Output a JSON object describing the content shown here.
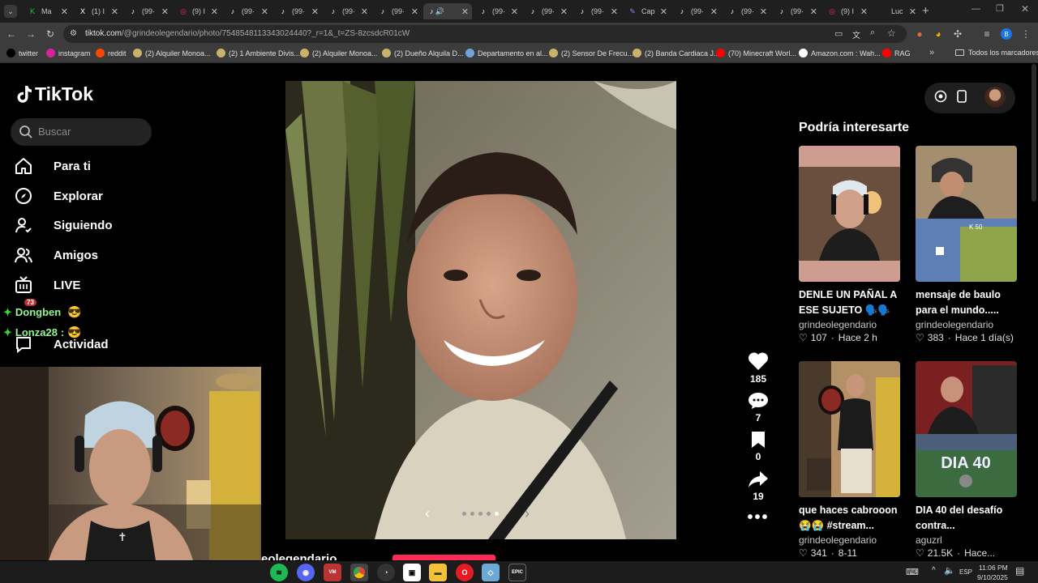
{
  "browser": {
    "tabs": [
      {
        "label": "Ma",
        "icon": "green-k-icon"
      },
      {
        "label": "(1) I",
        "icon": "x-icon"
      },
      {
        "label": "(99·",
        "icon": "tiktok-icon"
      },
      {
        "label": "(9) I",
        "icon": "instagram-icon"
      },
      {
        "label": "(99·",
        "icon": "tiktok-icon"
      },
      {
        "label": "(99·",
        "icon": "tiktok-icon"
      },
      {
        "label": "(99·",
        "icon": "tiktok-icon"
      },
      {
        "label": "(99·",
        "icon": "tiktok-icon"
      },
      {
        "label": "",
        "icon": "tiktok-icon"
      },
      {
        "label": "(99·",
        "icon": "tiktok-icon"
      },
      {
        "label": "(99·",
        "icon": "tiktok-icon"
      },
      {
        "label": "(99·",
        "icon": "tiktok-icon"
      },
      {
        "label": "Cap",
        "icon": "pen-icon"
      },
      {
        "label": "(99·",
        "icon": "tiktok-icon"
      },
      {
        "label": "(99·",
        "icon": "tiktok-icon"
      },
      {
        "label": "(99·",
        "icon": "tiktok-icon"
      },
      {
        "label": "(9) I",
        "icon": "instagram-icon"
      },
      {
        "label": "Luc",
        "icon": "blank-icon"
      }
    ],
    "url_domain": "tiktok.com",
    "url_path": "/@grindeolegendario/photo/7548548113343024440?_r=1&_t=ZS-8zcsdcR01cW",
    "bookmarks": [
      {
        "label": "twitter",
        "color": "#000000"
      },
      {
        "label": "instagram",
        "color": "#d6249f"
      },
      {
        "label": "reddit",
        "color": "#ff4500"
      },
      {
        "label": "(2) Alquiler Monoa...",
        "color": "#c9b36b"
      },
      {
        "label": "(2) 1 Ambiente Divis...",
        "color": "#c9b36b"
      },
      {
        "label": "(2) Alquiler Monoa...",
        "color": "#c9b36b"
      },
      {
        "label": "(2) Dueño Alquila D...",
        "color": "#c9b36b"
      },
      {
        "label": "Departamento en al...",
        "color": "#6fa3d8"
      },
      {
        "label": "(2) Sensor De Frecu...",
        "color": "#c9b36b"
      },
      {
        "label": "(2) Banda Cardiaca J...",
        "color": "#c9b36b"
      },
      {
        "label": "(70) Minecraft Worl...",
        "color": "#ff0000"
      },
      {
        "label": "Amazon.com : Wah...",
        "color": "#ffffff"
      },
      {
        "label": "RAG",
        "color": "#ff0000"
      }
    ],
    "all_bookmarks": "Todos los marcadores"
  },
  "tiktok": {
    "logo": "TikTok",
    "search_placeholder": "Buscar",
    "nav": [
      {
        "label": "Para ti",
        "icon": "home-icon"
      },
      {
        "label": "Explorar",
        "icon": "compass-icon"
      },
      {
        "label": "Siguiendo",
        "icon": "following-icon"
      },
      {
        "label": "Amigos",
        "icon": "friends-icon"
      },
      {
        "label": "LIVE",
        "icon": "live-icon"
      },
      {
        "label": "Actividad",
        "icon": "activity-icon"
      }
    ],
    "chat": [
      {
        "user": "Dongben",
        "sep": "",
        "badge": "73"
      },
      {
        "user": "Lonza28",
        "sep": ":",
        "badge": ""
      }
    ],
    "author_partial": "eolegendario",
    "actions": {
      "likes": "185",
      "comments": "7",
      "saves": "0",
      "shares": "19"
    },
    "carousel": {
      "count": 5,
      "active": 4
    },
    "recommend_title": "Podría interesarte",
    "recommendations": [
      {
        "title": "DENLE UN PAÑAL A ESE SUJETO 🗣️🗣️🔥...",
        "author": "grindeolegendario",
        "likes": "107",
        "time": "Hace 2 h"
      },
      {
        "title": "mensaje de baulo para el mundo.....",
        "author": "grindeolegendario",
        "likes": "383",
        "time": "Hace 1 día(s)"
      },
      {
        "title": "que haces cabrooon 😭😭 #stream...",
        "author": "grindeolegendario",
        "likes": "341",
        "time": "8-11"
      },
      {
        "title": "DIA 40 del desafío contra...",
        "author": "aguzrl",
        "likes": "21.5K",
        "time": "Hace..."
      }
    ],
    "thumb_overlay": "DIA 40"
  },
  "taskbar": {
    "lang": "ESP",
    "time": "11:06 PM",
    "date": "9/10/2025"
  }
}
